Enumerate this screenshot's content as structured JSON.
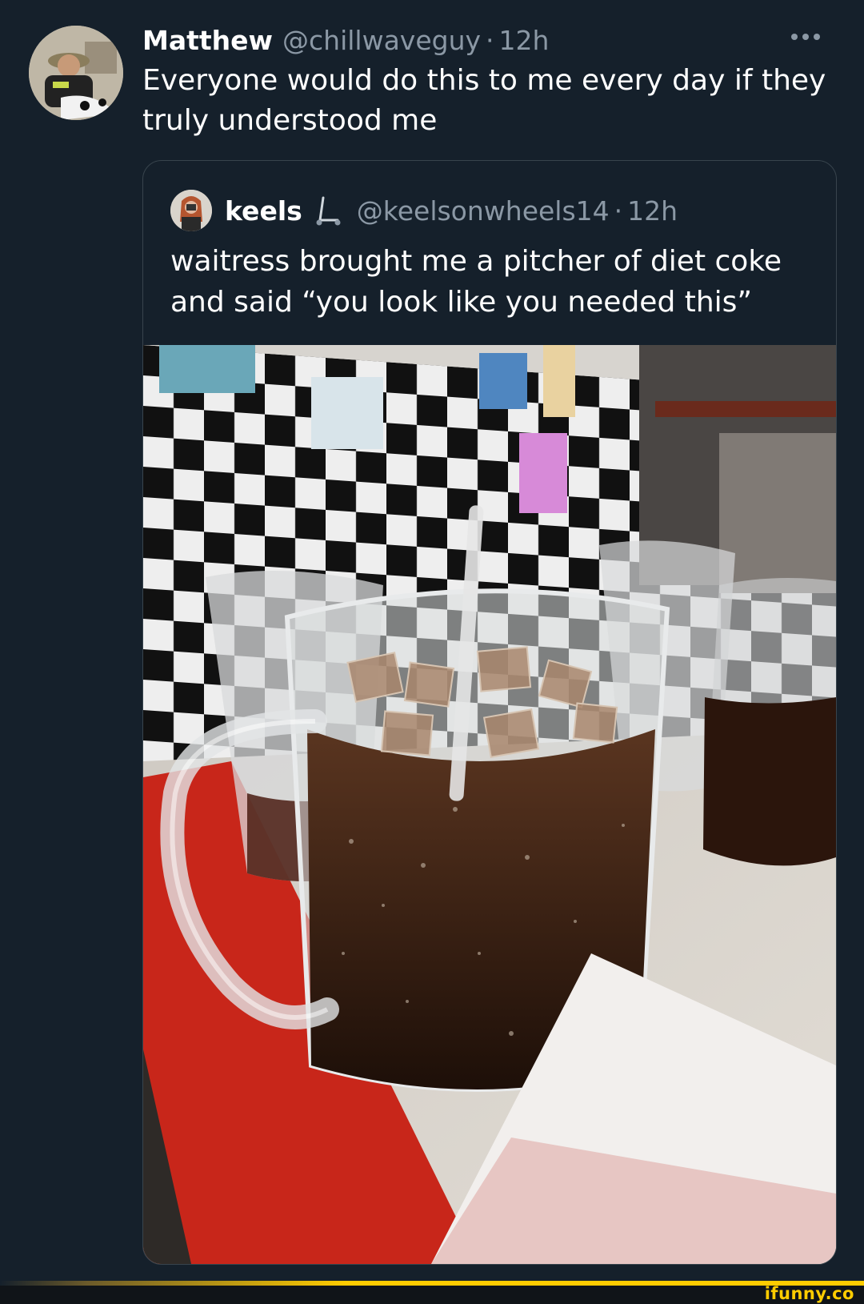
{
  "tweet": {
    "author_name": "Matthew",
    "author_handle": "@chillwaveguy",
    "separator": "·",
    "time": "12h",
    "text": "Everyone would do this to me every day if they truly understood me"
  },
  "quoted_tweet": {
    "author_name": "keels",
    "author_handle": "@keelsonwheels14",
    "separator": "·",
    "time": "12h",
    "name_emoji": "scooter-icon",
    "text": "waitress brought me a pitcher of diet coke and said “you look like you needed this”",
    "photo_description_icon": "pitcher-of-soda-photo"
  },
  "watermark": {
    "text": "ifunny.co"
  },
  "colors": {
    "background": "#15202b",
    "secondary_text": "#8b98a5",
    "border": "#38444d",
    "watermark": "#ffcc00"
  }
}
